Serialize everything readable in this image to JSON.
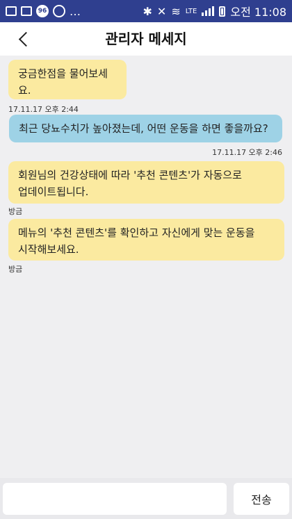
{
  "status_bar": {
    "network": "LTE",
    "time": "오전 11:08",
    "notification_badge": "96",
    "icons": [
      "notification-icon",
      "image-icon",
      "app-badge-icon",
      "sync-icon",
      "more-notifications-icon",
      "bluetooth-icon",
      "mute-icon",
      "wifi-icon",
      "signal-icon",
      "battery-icon"
    ]
  },
  "header": {
    "title": "관리자 메세지",
    "back_icon": "chevron-left-icon"
  },
  "messages": [
    {
      "sender": "admin",
      "text": "궁금한점을 물어보세요.",
      "time": "17.11.17 오후 2:44"
    },
    {
      "sender": "user",
      "text": "최근 당뇨수치가 높아졌는데, 어떤 운동을 하면 좋을까요?",
      "time": "17.11.17 오후 2:46"
    },
    {
      "sender": "admin",
      "lines": [
        "회원님의 건강상태에 따라 '추천 콘텐츠'가 자동으로",
        "업데이트됩니다."
      ],
      "time": "방금"
    },
    {
      "sender": "admin",
      "lines": [
        "메뉴의 '추천 콘텐츠'를 확인하고 자신에게 맞는 운동을",
        "시작해보세요."
      ],
      "time": "방금"
    }
  ],
  "composer": {
    "input_value": "",
    "send_label": "전송"
  },
  "colors": {
    "status_bar": "#2f3f8f",
    "admin_bubble": "#fbeaa0",
    "user_bubble": "#9ed2e6",
    "chat_background": "#efeff1"
  }
}
